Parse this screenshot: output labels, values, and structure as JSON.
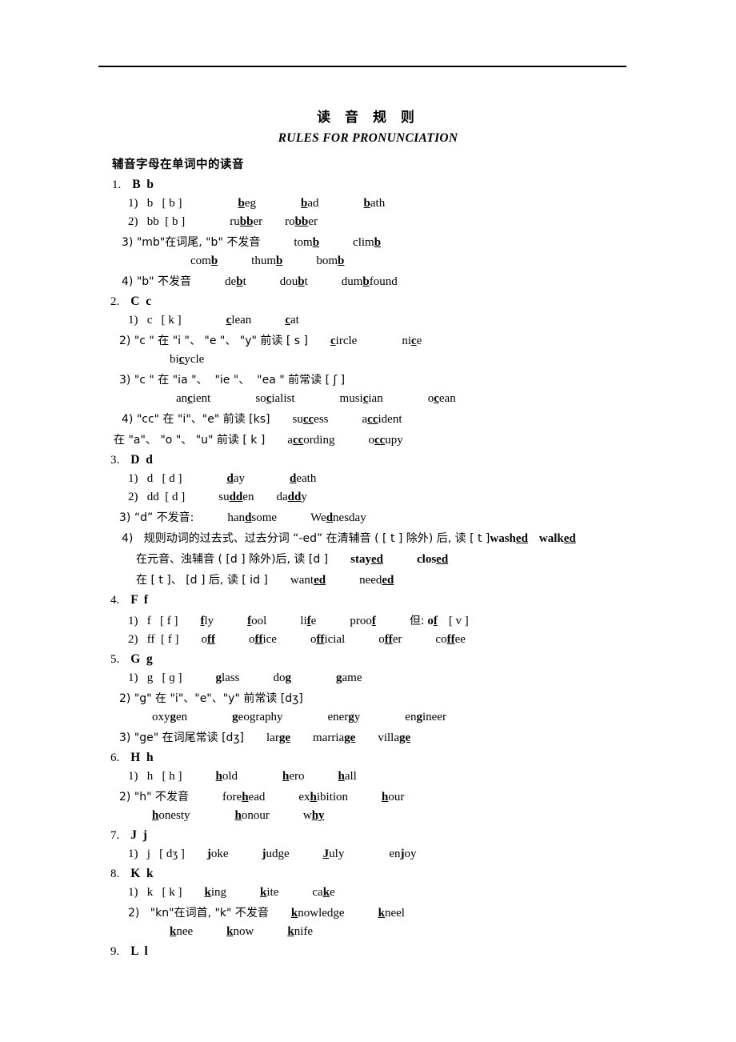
{
  "document": {
    "title_cn": "读 音 规 则",
    "title_en": "RULES FOR   PRONUNCIATION",
    "section_heading": "辅音字母在单词中的读音"
  },
  "entries": [
    {
      "index": "1.",
      "letter": "B  b",
      "rules": [
        {
          "marker": "1)",
          "text": "b   [ b ]",
          "examples": [
            "beg",
            "bad",
            "bath"
          ]
        },
        {
          "marker": "2)",
          "text": "bb  [ b ]",
          "examples": [
            "rubber",
            "robber"
          ]
        },
        {
          "marker": "3)",
          "text": "\"mb\"在词尾, \"b\" 不发音",
          "examples": [
            "tomb",
            "climb"
          ]
        },
        {
          "marker": "",
          "text": "",
          "examples": [
            "comb",
            "thumb",
            "bomb"
          ]
        },
        {
          "marker": "4)",
          "text": "\"b\" 不发音",
          "examples": [
            "debt",
            "doubt",
            "dumbfound"
          ]
        }
      ]
    },
    {
      "index": "2.",
      "letter": "C  c",
      "rules": [
        {
          "marker": "1)",
          "text": "c   [ k ]",
          "examples": [
            "clean",
            "cat"
          ]
        },
        {
          "marker": "2)",
          "text": "\"c \" 在 \"i \"、\"e \"、\"y\" 前读 [ s ]",
          "examples": [
            "circle",
            "nice"
          ]
        },
        {
          "marker": "",
          "text": "",
          "examples": [
            "bicycle"
          ]
        },
        {
          "marker": "3)",
          "text": "\"c \" 在 \"ia \"、 \"ie \"、 \"ea \" 前常读 [ ʃ ]",
          "examples": []
        },
        {
          "marker": "",
          "text": "",
          "examples": [
            "ancient",
            "socialist",
            "musician",
            "ocean"
          ]
        },
        {
          "marker": "4)",
          "text": "\"cc\" 在 \"i\"、\"e\" 前读 [ks]",
          "examples": [
            "success",
            "accident"
          ]
        },
        {
          "marker": "",
          "text": "在 \"a\"、 \"o \"、 \"u\" 前读 [ k ]",
          "examples": [
            "according",
            "occupy"
          ]
        }
      ]
    },
    {
      "index": "3.",
      "letter": "D  d",
      "rules": [
        {
          "marker": "1)",
          "text": "d   [ d ]",
          "examples": [
            "day",
            "death"
          ]
        },
        {
          "marker": "2)",
          "text": "dd  [ d ]",
          "examples": [
            "sudden",
            "daddy"
          ]
        },
        {
          "marker": "3)",
          "text": "“d” 不发音:",
          "examples": [
            "handsome",
            "Wednesday"
          ]
        },
        {
          "marker": "4)",
          "text": "规则动词的过去式、过去分词 “-ed” 在清辅音 ( [ t ] 除外) 后, 读 [ t ]",
          "examples": [
            "washed",
            "walked"
          ]
        },
        {
          "marker": "",
          "text": "在元音、浊辅音 ( [d ] 除外)后, 读 [d ]",
          "examples": [
            "stayed",
            "closed"
          ]
        },
        {
          "marker": "",
          "text": "在 [ t ]、 [d ] 后, 读 [ id ]",
          "examples": [
            "wanted",
            "needed"
          ]
        }
      ]
    },
    {
      "index": "4.",
      "letter": "F  f",
      "rules": [
        {
          "marker": "1)",
          "text": "f   [ f ]",
          "examples": [
            "fly",
            "fool",
            "life",
            "proof",
            "但: of  [ v ]"
          ]
        },
        {
          "marker": "2)",
          "text": "ff  [ f ]",
          "examples": [
            "off",
            "office",
            "official",
            "offer",
            "coffee"
          ]
        }
      ]
    },
    {
      "index": "5.",
      "letter": "G  g",
      "rules": [
        {
          "marker": "1)",
          "text": "g   [ ɡ ]",
          "examples": [
            "glass",
            "dog",
            "game"
          ]
        },
        {
          "marker": "2)",
          "text": "\"g\" 在 \"i\"、\"e\"、\"y\" 前常读 [dʒ]",
          "examples": []
        },
        {
          "marker": "",
          "text": "",
          "examples": [
            "oxygen",
            "geography",
            "energy",
            "engineer"
          ]
        },
        {
          "marker": "3)",
          "text": "\"ge\" 在词尾常读 [dʒ]",
          "examples": [
            "large",
            "marriage",
            "village"
          ]
        }
      ]
    },
    {
      "index": "6.",
      "letter": "H  h",
      "rules": [
        {
          "marker": "1)",
          "text": "h   [ h ]",
          "examples": [
            "hold",
            "hero",
            "hall"
          ]
        },
        {
          "marker": "2)",
          "text": "\"h\" 不发音",
          "examples": [
            "forehead",
            "exhibition",
            "hour"
          ]
        },
        {
          "marker": "",
          "text": "",
          "examples": [
            "honesty",
            "honour",
            "why"
          ]
        }
      ]
    },
    {
      "index": "7.",
      "letter": "J  j",
      "rules": [
        {
          "marker": "1)",
          "text": "j   [ dʒ ]",
          "examples": [
            "joke",
            "judge",
            "July",
            "enjoy"
          ]
        }
      ]
    },
    {
      "index": "8.",
      "letter": "K  k",
      "rules": [
        {
          "marker": "1)",
          "text": "k   [ k ]",
          "examples": [
            "king",
            "kite",
            "cake"
          ]
        },
        {
          "marker": "2)",
          "text": "\"kn\"在词首, \"k\" 不发音",
          "examples": [
            "knowledge",
            "kneel"
          ]
        },
        {
          "marker": "",
          "text": "",
          "examples": [
            "knee",
            "know",
            "knife"
          ]
        }
      ]
    },
    {
      "index": "9.",
      "letter": "L  l",
      "rules": []
    }
  ],
  "lines": {
    "b1": "1)   b   [ b ]",
    "b2": "2)   bb  [ b ]",
    "b3": "3) \"mb\"在词尾, \"b\" 不发音",
    "b4": "4) \"b\" 不发音",
    "c1": "1)   c   [ k ]",
    "c2": "2) \"c \" 在 \"i \"、 \"e \"、 \"y\" 前读 [ s ]",
    "c3": "3) \"c \" 在 \"ia \"、  \"ie \"、  \"ea \" 前常读 [ ʃ ]",
    "c4": "4) \"cc\" 在 \"i\"、\"e\" 前读 [ks]",
    "c5": "在 \"a\"、 \"o \"、 \"u\" 前读 [ k ]",
    "d1": "1)   d   [ d ]",
    "d2": "2)   dd  [ d ]",
    "d3": "3) “d” 不发音:",
    "d4": "4)   规则动词的过去式、过去分词 “-ed” 在清辅音 ( [ t ] 除外) 后, 读 [ t ]",
    "d5": "在元音、浊辅音 ( [d ] 除外)后, 读 [d ]",
    "d6": "在 [ t ]、 [d ] 后, 读 [ id ]",
    "f1": "1)   f   [ f ]",
    "f2": "2)   ff  [ f ]",
    "g1": "1)   g   [ ɡ ]",
    "g2": "2) \"g\" 在 \"i\"、\"e\"、\"y\" 前常读 [dʒ]",
    "g3": "3) \"ge\" 在词尾常读 [dʒ]",
    "h1": "1)   h   [ h ]",
    "h2": "2) \"h\" 不发音",
    "j1": "1)   j   [ dʒ ]",
    "k1": "1)   k   [ k ]",
    "k2": "2)   \"kn\"在词首, \"k\" 不发音"
  }
}
